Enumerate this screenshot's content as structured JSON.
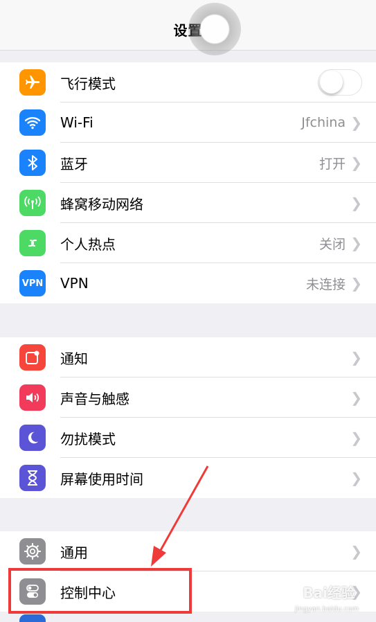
{
  "nav": {
    "title": "设置"
  },
  "groups": [
    {
      "rows": [
        {
          "label": "飞行模式",
          "toggle": false,
          "icon_name": "airplane-icon",
          "color": "#ff9500"
        },
        {
          "label": "Wi-Fi",
          "value": "Jfchina",
          "icon_name": "wifi-icon",
          "color": "#1a82fb"
        },
        {
          "label": "蓝牙",
          "value": "打开",
          "icon_name": "bluetooth-icon",
          "color": "#1a82fb"
        },
        {
          "label": "蜂窝移动网络",
          "icon_name": "cellular-icon",
          "color": "#4cd964"
        },
        {
          "label": "个人热点",
          "value": "关闭",
          "icon_name": "hotspot-icon",
          "color": "#4cd964"
        },
        {
          "label": "VPN",
          "value": "未连接",
          "icon_name": "vpn-icon",
          "icon_text": "VPN",
          "color": "#1a82fb"
        }
      ]
    },
    {
      "rows": [
        {
          "label": "通知",
          "icon_name": "notifications-icon",
          "color": "#f6463b"
        },
        {
          "label": "声音与触感",
          "icon_name": "sound-icon",
          "color": "#f23b5b"
        },
        {
          "label": "勿扰模式",
          "icon_name": "moon-icon",
          "color": "#5b54d6"
        },
        {
          "label": "屏幕使用时间",
          "icon_name": "hourglass-icon",
          "color": "#5b54d6"
        }
      ]
    },
    {
      "rows": [
        {
          "label": "通用",
          "icon_name": "gear-icon",
          "color": "#8e8e93"
        },
        {
          "label": "控制中心",
          "icon_name": "control-center-icon",
          "color": "#8e8e93"
        }
      ]
    }
  ],
  "annotation_color": "#ef3a3a",
  "watermark": {
    "brand": "Bai经验",
    "url": "jingyan.baidu.com"
  }
}
